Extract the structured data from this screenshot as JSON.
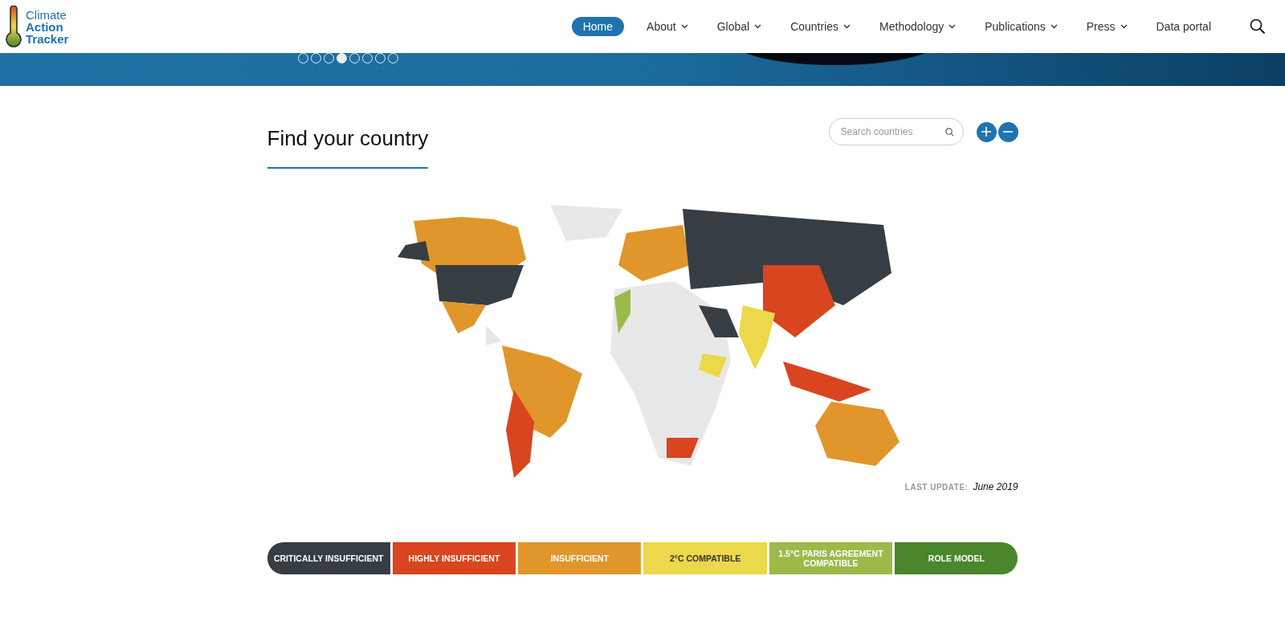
{
  "logo": {
    "line_1": "Climate",
    "line_2": "Action",
    "line_3": "Tracker"
  },
  "nav": [
    {
      "label": "Home",
      "selected": true,
      "has_menu": false
    },
    {
      "label": "About",
      "selected": false,
      "has_menu": true
    },
    {
      "label": "Global",
      "selected": false,
      "has_menu": true
    },
    {
      "label": "Countries",
      "selected": false,
      "has_menu": true
    },
    {
      "label": "Methodology",
      "selected": false,
      "has_menu": true
    },
    {
      "label": "Publications",
      "selected": false,
      "has_menu": true
    },
    {
      "label": "Press",
      "selected": false,
      "has_menu": true
    },
    {
      "label": "Data portal",
      "selected": false,
      "has_menu": false
    }
  ],
  "carousel_dots": [
    {
      "selected": false
    },
    {
      "selected": false
    },
    {
      "selected": false
    },
    {
      "selected": true
    },
    {
      "selected": false
    },
    {
      "selected": false
    },
    {
      "selected": false
    },
    {
      "selected": false
    }
  ],
  "heading": "Find your country",
  "search": {
    "placeholder": "Search countries"
  },
  "last_update": {
    "label": "LAST UPDATE:",
    "value": "June 2019"
  },
  "legend": [
    {
      "label": "CRITICALLY INSUFFICIENT",
      "color": "#363e44"
    },
    {
      "label": "HIGHLY INSUFFICIENT",
      "color": "#d8451e"
    },
    {
      "label": "INSUFFICIENT",
      "color": "#e0962b"
    },
    {
      "label": "2°C COMPATIBLE",
      "color": "#ecd84a"
    },
    {
      "label": "1.5°C PARIS AGREEMENT COMPATIBLE",
      "color": "#9cba4a"
    },
    {
      "label": "ROLE MODEL",
      "color": "#4a862c"
    }
  ]
}
